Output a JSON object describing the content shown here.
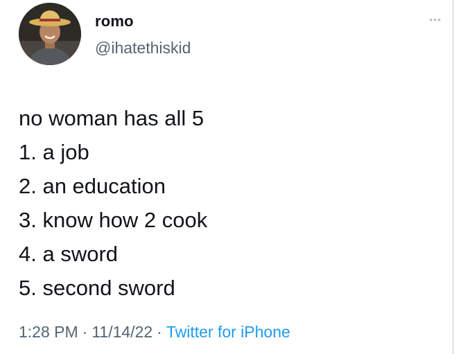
{
  "user": {
    "display_name": "romo",
    "handle": "@ihatethiskid"
  },
  "tweet": {
    "lines": [
      "no woman has all 5",
      "1. a job",
      "2. an education",
      "3. know how 2 cook",
      "4. a sword",
      "5. second sword"
    ]
  },
  "meta": {
    "time": "1:28 PM",
    "separator": "·",
    "date": "11/14/22",
    "source": "Twitter for iPhone"
  },
  "icons": {
    "more": "more-horizontal-icon"
  },
  "colors": {
    "secondary_text": "#536471",
    "link": "#1d9bf0",
    "text": "#0f1419"
  }
}
